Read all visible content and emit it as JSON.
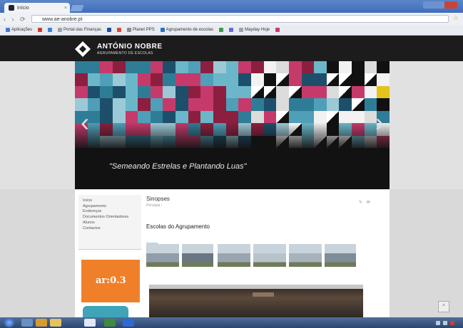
{
  "browser": {
    "tab_title": "Início",
    "url": "www.ae-anobre.pt",
    "nav_glyphs": "‹ › ⟳",
    "bookmarks": [
      {
        "label": "Aplicações",
        "color": "#4b78c8"
      },
      {
        "label": "",
        "color": "#d23b2b"
      },
      {
        "label": "",
        "color": "#3b82d6"
      },
      {
        "label": "Portal das Finanças",
        "color": "#9aa3ad"
      },
      {
        "label": "",
        "color": "#1d4e9e"
      },
      {
        "label": "",
        "color": "#d84a3a"
      },
      {
        "label": "Planet PPS",
        "color": "#8c8c8c"
      },
      {
        "label": "Agrupamento de escolas",
        "color": "#2a6fc9"
      },
      {
        "label": "",
        "color": "#3b9a4b"
      },
      {
        "label": "",
        "color": "#6b6bd6"
      },
      {
        "label": "Mayday Hoje",
        "color": "#9aa3ad"
      },
      {
        "label": "",
        "color": "#c93b6f"
      }
    ]
  },
  "site": {
    "brand_name": "ANTÓNIO NOBRE",
    "brand_sub": "AGRUPAMENTO DE ESCOLAS",
    "slider": {
      "caption": "\"Semeando Estrelas e Plantando Luas\"",
      "prev_glyph": "‹",
      "next_glyph": "›"
    },
    "sidebar_menu": [
      "Início",
      "Agrupamento",
      "Endereços",
      "Documentos Orientadores",
      "Alunos",
      "Contactos"
    ],
    "partner_logo_text": "ar:0.3",
    "section_title": "Sinopses",
    "breadcrumb": "Principal  ›",
    "share_glyphs": "✎ ✉",
    "heading": "Escolas do Agrupamento",
    "tag_label": "Sinopses",
    "scroll_up_glyph": "^"
  },
  "colors": {
    "mosaic": [
      "#c63a6b",
      "#8c1f3f",
      "#4f9fb8",
      "#2f7c97",
      "#6bb7c9",
      "#9cc9d6",
      "#1d4f6b",
      "#dcdcdc",
      "#f2f2f2",
      "#111111",
      "#e3c31c",
      "#3a3a3a"
    ],
    "header_bg": "#1c1c1c",
    "partner_orange": "#f07f2a"
  },
  "gallery": [
    "#8f9eaa",
    "#6a7684",
    "#9aa5b0",
    "#b9c3cc",
    "#a8b2bc",
    "#7f8d99"
  ]
}
